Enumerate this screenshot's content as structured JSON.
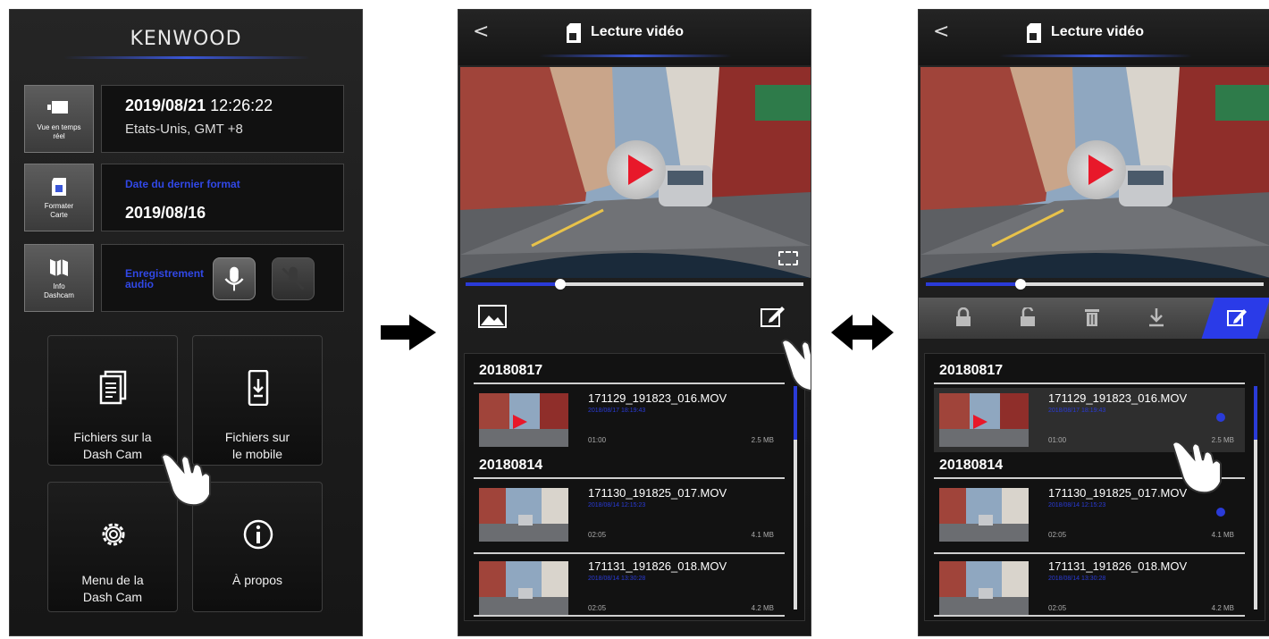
{
  "screen1": {
    "brand": "KENWOOD",
    "live_view_label": "Vue en temps réel",
    "datetime": {
      "date": "2019/08/21",
      "time": "12:26:22",
      "region": "Etats-Unis, GMT +8"
    },
    "format_card_label": "Formater Carte",
    "last_format": {
      "label": "Date du dernier format",
      "date": "2019/08/16"
    },
    "dashcam_info_label": "Info Dashcam",
    "audio_recording_label": "Enregistrement audio",
    "tiles": [
      {
        "label_line1": "Fichiers sur la",
        "label_line2": "Dash Cam",
        "icon": "documents-icon"
      },
      {
        "label_line1": "Fichiers sur",
        "label_line2": "le mobile",
        "icon": "phone-download-icon"
      },
      {
        "label_line1": "Menu de la",
        "label_line2": "Dash Cam",
        "icon": "gear-icon"
      },
      {
        "label_line1": "À propos",
        "label_line2": "",
        "icon": "info-icon"
      }
    ]
  },
  "screen2": {
    "back": "<",
    "title": "Lecture vidéo",
    "progress": 0.28,
    "groups": [
      {
        "date": "20180817",
        "files": [
          {
            "name": "171129_191823_016.MOV",
            "timestamp": "2018/08/17 18:19:43",
            "duration": "01:00",
            "size": "2.5 MB"
          }
        ]
      },
      {
        "date": "20180814",
        "files": [
          {
            "name": "171130_191825_017.MOV",
            "timestamp": "2018/08/14 12:15:23",
            "duration": "02:05",
            "size": "4.1 MB"
          },
          {
            "name": "171131_191826_018.MOV",
            "timestamp": "2018/08/14 13:30:28",
            "duration": "02:05",
            "size": "4.2 MB"
          }
        ]
      }
    ]
  },
  "screen3": {
    "back": "<",
    "title": "Lecture vidéo",
    "progress": 0.28,
    "toolbar": [
      "lock-icon",
      "unlock-icon",
      "trash-icon",
      "download-icon",
      "edit-icon"
    ],
    "groups": [
      {
        "date": "20180817",
        "files": [
          {
            "name": "171129_191823_016.MOV",
            "timestamp": "2018/08/17 18:19:43",
            "duration": "01:00",
            "size": "2.5 MB"
          }
        ]
      },
      {
        "date": "20180814",
        "files": [
          {
            "name": "171130_191825_017.MOV",
            "timestamp": "2018/08/14 12:15:23",
            "duration": "02:05",
            "size": "4.1 MB"
          },
          {
            "name": "171131_191826_018.MOV",
            "timestamp": "2018/08/14 13:30:28",
            "duration": "02:05",
            "size": "4.2 MB"
          }
        ]
      }
    ]
  },
  "colors": {
    "accent": "#2a3be8",
    "label_blue": "#3148e6",
    "panel": "#111111"
  }
}
